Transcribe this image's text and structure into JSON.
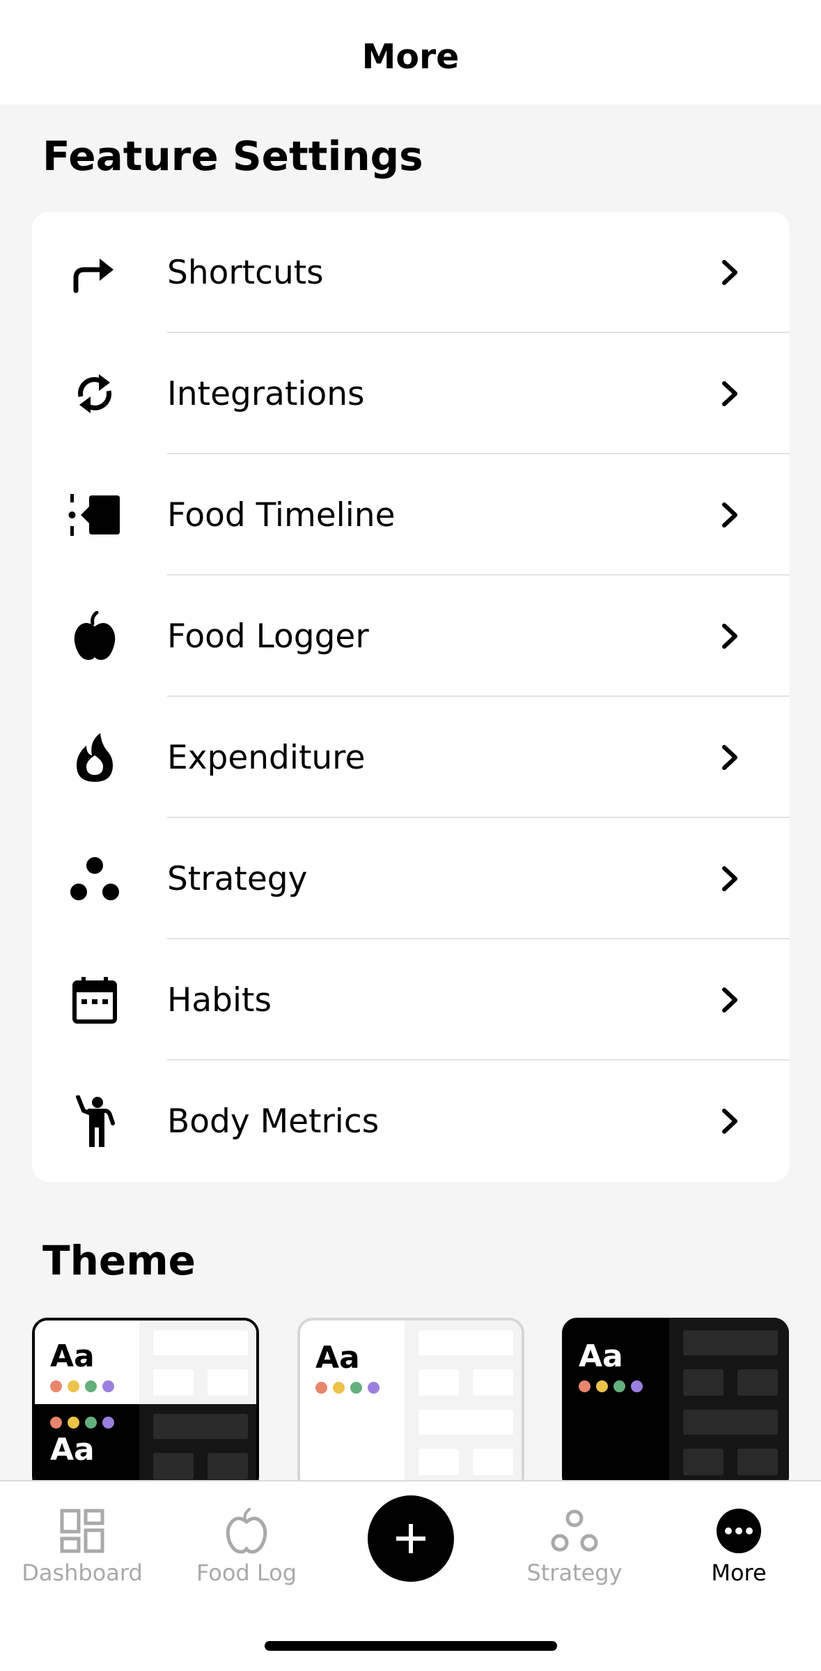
{
  "header": {
    "title": "More"
  },
  "feature_settings": {
    "title": "Feature Settings",
    "items": [
      {
        "label": "Shortcuts",
        "icon": "arrow-forward-icon"
      },
      {
        "label": "Integrations",
        "icon": "sync-icon"
      },
      {
        "label": "Food Timeline",
        "icon": "timeline-icon"
      },
      {
        "label": "Food Logger",
        "icon": "apple-icon"
      },
      {
        "label": "Expenditure",
        "icon": "flame-icon"
      },
      {
        "label": "Strategy",
        "icon": "three-dots-cluster-icon"
      },
      {
        "label": "Habits",
        "icon": "calendar-icon"
      },
      {
        "label": "Body Metrics",
        "icon": "person-waving-icon"
      }
    ]
  },
  "theme": {
    "title": "Theme",
    "options": [
      {
        "name": "auto",
        "label_top": "Aa",
        "label_bottom": "Aa",
        "selected": true
      },
      {
        "name": "light",
        "label": "Aa",
        "selected": false
      },
      {
        "name": "dark",
        "label": "Aa",
        "selected": false
      }
    ],
    "swatch_colors": [
      "#e8866b",
      "#ecc24a",
      "#64b07c",
      "#9b7fe0"
    ]
  },
  "tabbar": {
    "tabs": [
      {
        "label": "Dashboard",
        "icon": "dashboard-icon",
        "active": false
      },
      {
        "label": "Food Log",
        "icon": "apple-outline-icon",
        "active": false
      },
      {
        "label": "Strategy",
        "icon": "strategy-icon",
        "active": false
      },
      {
        "label": "More",
        "icon": "more-icon",
        "active": true
      }
    ],
    "add_icon": "plus-icon"
  },
  "colors": {
    "accent": "#000000",
    "inactive": "#a9a9a9",
    "background": "#f5f5f5"
  }
}
